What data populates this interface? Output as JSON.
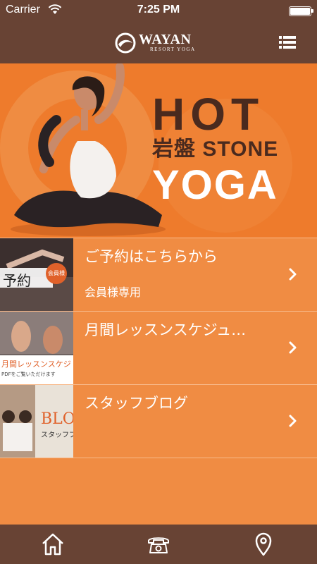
{
  "status_bar": {
    "carrier": "Carrier",
    "time": "7:25 PM"
  },
  "nav": {
    "logo_name": "WAYAN",
    "logo_sub": "RESORT YOGA"
  },
  "hero": {
    "line1": "HOT",
    "line2": "岩盤 STONE",
    "line3": "YOGA"
  },
  "menu": {
    "items": [
      {
        "title": "ご予約はこちらから",
        "subtitle": "会員様専用",
        "thumb_text": "予約",
        "thumb_badge": "会員様"
      },
      {
        "title": "月間レッスンスケジュ…",
        "subtitle": "",
        "thumb_text": "月間レッスンスケジ",
        "thumb_sub": "PDFをご覧いただけます"
      },
      {
        "title": "スタッフブログ",
        "subtitle": "",
        "thumb_text": "BLO",
        "thumb_sub": "スタッフブ"
      }
    ]
  },
  "colors": {
    "brown": "#684334",
    "orange": "#f08c43",
    "hero_orange": "#ee7b2c"
  },
  "icons": {
    "tabs": [
      "home-icon",
      "phone-icon",
      "map-pin-icon"
    ]
  }
}
